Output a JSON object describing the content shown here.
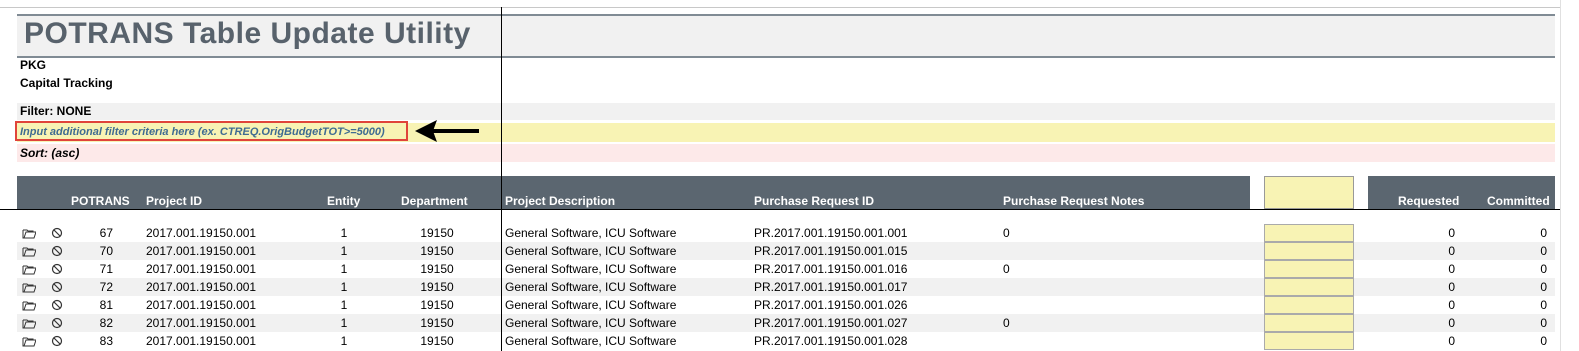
{
  "title": "POTRANS Table Update Utility",
  "company": "PKG",
  "module": "Capital Tracking",
  "filter_label": "Filter: NONE",
  "filter_input_placeholder": "Input additional filter criteria here (ex. CTREQ.OrigBudgetTOT>=5000)",
  "sort_label": "Sort:  (asc)",
  "colors": {
    "header_bg": "#5b6670",
    "yellow": "#f8f3b4",
    "pink": "#fde9e9",
    "highlight_border": "#e0443a",
    "title": "#58626c"
  },
  "columns": {
    "potrans": "POTRANS",
    "project_id": "Project ID",
    "entity": "Entity",
    "department": "Department",
    "project_description": "Project Description",
    "purchase_request_id": "Purchase Request ID",
    "purchase_request_notes": "Purchase Request Notes",
    "requested": "Requested",
    "committed": "Committed"
  },
  "rows": [
    {
      "potrans": "67",
      "project_id": "2017.001.19150.001",
      "entity": "1",
      "department": "19150",
      "description": "General Software, ICU Software",
      "pr_id": "PR.2017.001.19150.001.001",
      "notes": "0",
      "requested": "0",
      "committed": "0"
    },
    {
      "potrans": "70",
      "project_id": "2017.001.19150.001",
      "entity": "1",
      "department": "19150",
      "description": "General Software, ICU Software",
      "pr_id": "PR.2017.001.19150.001.015",
      "notes": "",
      "requested": "0",
      "committed": "0"
    },
    {
      "potrans": "71",
      "project_id": "2017.001.19150.001",
      "entity": "1",
      "department": "19150",
      "description": "General Software, ICU Software",
      "pr_id": "PR.2017.001.19150.001.016",
      "notes": "0",
      "requested": "0",
      "committed": "0"
    },
    {
      "potrans": "72",
      "project_id": "2017.001.19150.001",
      "entity": "1",
      "department": "19150",
      "description": "General Software, ICU Software",
      "pr_id": "PR.2017.001.19150.001.017",
      "notes": "",
      "requested": "0",
      "committed": "0"
    },
    {
      "potrans": "81",
      "project_id": "2017.001.19150.001",
      "entity": "1",
      "department": "19150",
      "description": "General Software, ICU Software",
      "pr_id": "PR.2017.001.19150.001.026",
      "notes": "",
      "requested": "0",
      "committed": "0"
    },
    {
      "potrans": "82",
      "project_id": "2017.001.19150.001",
      "entity": "1",
      "department": "19150",
      "description": "General Software, ICU Software",
      "pr_id": "PR.2017.001.19150.001.027",
      "notes": "0",
      "requested": "0",
      "committed": "0"
    },
    {
      "potrans": "83",
      "project_id": "2017.001.19150.001",
      "entity": "1",
      "department": "19150",
      "description": "General Software, ICU Software",
      "pr_id": "PR.2017.001.19150.001.028",
      "notes": "",
      "requested": "0",
      "committed": "0"
    }
  ],
  "row_icons": [
    "open-folder-icon",
    "cancel-icon"
  ]
}
